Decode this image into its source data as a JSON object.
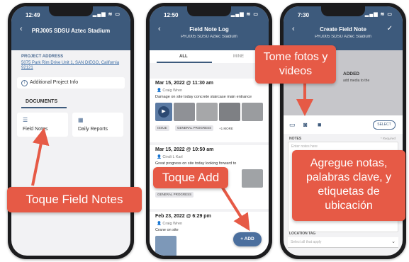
{
  "phone1": {
    "time": "12:49",
    "title": "PRJ005 SDSU Aztec Stadium",
    "address_label": "PROJECT ADDRESS",
    "address": "5075 Park Rim Drive Unit 1, SAN DIEGO, California 92121",
    "additional_info": "Additional Project Info",
    "documents_label": "DOCUMENTS",
    "tiles": [
      {
        "label": "Field Notes",
        "icon": "field-notes-icon"
      },
      {
        "label": "Daily Reports",
        "icon": "daily-reports-icon"
      }
    ]
  },
  "phone2": {
    "time": "12:50",
    "title": "Field Note Log",
    "subtitle": "PRJ005 SDSU Aztec Stadium",
    "tabs": [
      "ALL",
      "MINE"
    ],
    "entries": [
      {
        "date": "Mar 15, 2022 @ 11:30 am",
        "user": "Craig Wren",
        "desc": "Damage on site today concrete staircase main entrance",
        "chips": [
          "ISSUE",
          "GENERAL PROGRESS"
        ],
        "more": "+1 MORE"
      },
      {
        "date": "Mar 15, 2022 @ 10:50 am",
        "user": "Cindi L Karl",
        "desc": "Great progress on site today looking forward to",
        "chips": [
          "GENERAL PROGRESS"
        ],
        "more": ""
      },
      {
        "date": "Feb 23, 2022 @ 6:29 pm",
        "user": "Craig Wren",
        "desc": "Crane on site",
        "chips": [],
        "more": ""
      }
    ],
    "add_button": "+ ADD"
  },
  "phone3": {
    "time": "7:30",
    "title": "Create Field Note",
    "subtitle": "PRJ005 SDSU Aztec Stadium",
    "added_title": "ADDED",
    "added_sub": "add media to the",
    "select_label": "SELECT",
    "notes_label": "NOTES",
    "required": "* Required",
    "notes_placeholder": "Enter notes here",
    "location_label": "LOCATION TAG",
    "location_placeholder": "Select all that apply"
  },
  "callouts": {
    "field_notes": "Toque Field Notes",
    "add": "Toque Add",
    "photos": "Tome fotos y videos",
    "notes": "Agregue notas, palabras clave, y etiquetas de ubicación"
  },
  "colors": {
    "header": "#3d5a7c",
    "callout": "#e65a46"
  }
}
